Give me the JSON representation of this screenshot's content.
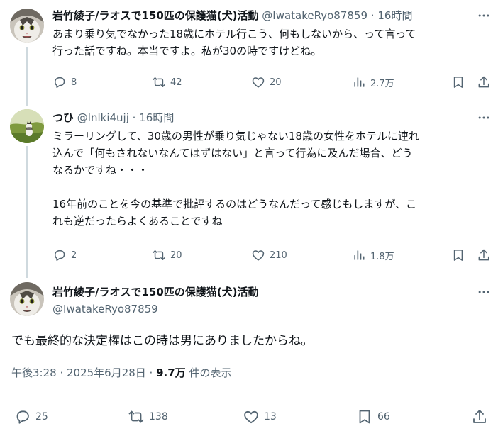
{
  "tweets": [
    {
      "display_name": "岩竹綾子/ラオスで150匹の保護猫(犬)活動",
      "handle": "@IwatakeRyo87859",
      "separator": "·",
      "time": "16時間",
      "text": [
        "あまり乗り気でなかった18歳にホテル行こう、何もしないから、って言って",
        "行った話ですね。本当ですよ。私が30の時ですけどね。"
      ],
      "replies": "8",
      "retweets": "42",
      "likes": "20",
      "views": "2.7万"
    },
    {
      "display_name": "つひ",
      "handle": "@lnlki4ujj",
      "separator": "·",
      "time": "16時間",
      "paragraphs": [
        [
          "ミラーリングして、30歳の男性が乗り気じゃない18歳の女性をホテルに連れ",
          "込んで「何もされないなんてはずはない」と言って行為に及んだ場合、どう",
          "なるかですね・・・"
        ],
        [
          "16年前のことを今の基準で批評するのはどうなんだって感じもしますが、こ",
          "れも逆だったらよくあることですね"
        ]
      ],
      "replies": "2",
      "retweets": "20",
      "likes": "210",
      "views": "1.8万"
    }
  ],
  "main_tweet": {
    "display_name": "岩竹綾子/ラオスで150匹の保護猫(犬)活動",
    "handle": "@IwatakeRyo87859",
    "text": "でも最終的な決定権はこの時は男にありましたからね。",
    "timestamp": "午後3:28 · 2025年6月28日 · ",
    "views_count": "9.7万",
    "views_label": " 件の表示",
    "replies": "25",
    "retweets": "138",
    "likes": "13",
    "bookmarks": "66"
  },
  "colors": {
    "text": "#0f1419",
    "secondary": "#536471",
    "thread_line": "#cfd9de",
    "divider": "#eff3f4"
  },
  "icons": [
    "reply-icon",
    "retweet-icon",
    "like-icon",
    "views-icon",
    "bookmark-icon",
    "share-icon",
    "more-icon"
  ]
}
